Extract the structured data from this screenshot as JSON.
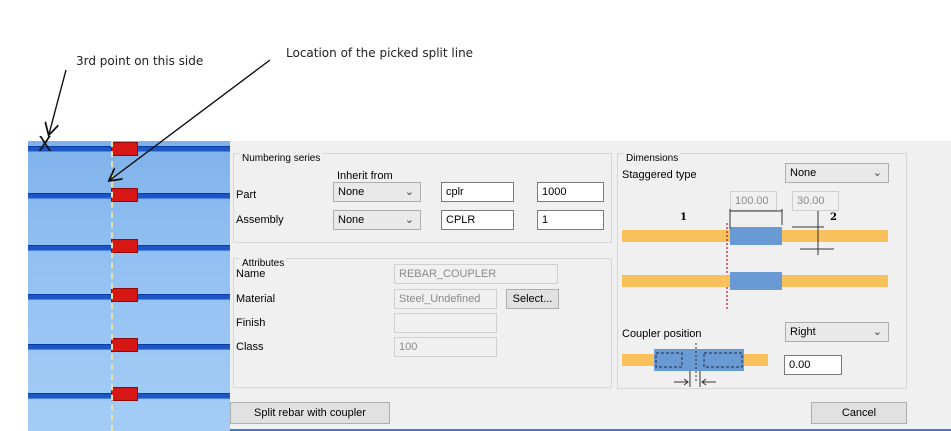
{
  "annotations": {
    "side_point": "3rd point on this side",
    "split_line": "Location of the picked split line",
    "cross_mark": "X"
  },
  "numbering": {
    "title": "Numbering series",
    "inherit_from": "Inherit from",
    "part_label": "Part",
    "part_inherit": "None",
    "part_prefix": "cplr",
    "part_start": "1000",
    "assembly_label": "Assembly",
    "assembly_inherit": "None",
    "assembly_prefix": "CPLR",
    "assembly_start": "1"
  },
  "attributes": {
    "title": "Attributes",
    "name_label": "Name",
    "name_value": "REBAR_COUPLER",
    "material_label": "Material",
    "material_value": "Steel_Undefined",
    "select_button": "Select...",
    "finish_label": "Finish",
    "finish_value": "",
    "class_label": "Class",
    "class_value": "100"
  },
  "dimensions": {
    "title": "Dimensions",
    "staggered_label": "Staggered type",
    "staggered_value": "None",
    "dim1": "100.00",
    "dim2": "30.00",
    "marker1": "1",
    "marker2": "2",
    "coupler_position_label": "Coupler position",
    "coupler_position_value": "Right",
    "offset_value": "0.00"
  },
  "buttons": {
    "split": "Split rebar with coupler",
    "cancel": "Cancel"
  },
  "colors": {
    "rebar_bar": "#f8c15c",
    "coupler_fill": "#6a9ad3",
    "model_rebar": "#1d57c7",
    "model_coupler": "#d71616"
  }
}
